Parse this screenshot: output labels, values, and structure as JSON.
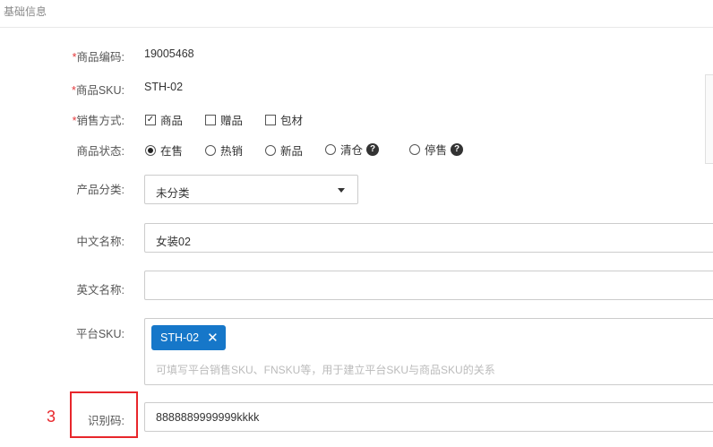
{
  "section": {
    "title": "基础信息"
  },
  "fields": {
    "code": {
      "required": "*",
      "label": "商品编码:",
      "value": "19005468"
    },
    "sku": {
      "required": "*",
      "label": "商品SKU:",
      "value": "STH-02"
    },
    "sale_mode": {
      "required": "*",
      "label": "销售方式:",
      "options": [
        {
          "label": "商品",
          "checked": true,
          "check_mark": "✓"
        },
        {
          "label": "赠品",
          "checked": false
        },
        {
          "label": "包材",
          "checked": false
        }
      ]
    },
    "status": {
      "label": "商品状态:",
      "options": [
        {
          "label": "在售",
          "selected": true
        },
        {
          "label": "热销",
          "selected": false
        },
        {
          "label": "新品",
          "selected": false
        },
        {
          "label": "清仓",
          "selected": false,
          "help": "?"
        },
        {
          "label": "停售",
          "selected": false,
          "help": "?"
        }
      ]
    },
    "category": {
      "label": "产品分类:",
      "value": "未分类"
    },
    "cn_name": {
      "label": "中文名称:",
      "value": "女装02"
    },
    "en_name": {
      "label": "英文名称:",
      "value": ""
    },
    "platform_sku": {
      "label": "平台SKU:",
      "tags": [
        {
          "label": "STH-02",
          "remove": "✕"
        }
      ],
      "hint": "可填写平台销售SKU、FNSKU等，用于建立平台SKU与商品SKU的关系"
    },
    "identifier": {
      "label": "识别码:",
      "value": "8888889999999kkkk"
    }
  },
  "annotation": {
    "number": "3",
    "color": "#e8262b"
  },
  "colors": {
    "tag": "#1677c9",
    "required": "#e4393c"
  }
}
